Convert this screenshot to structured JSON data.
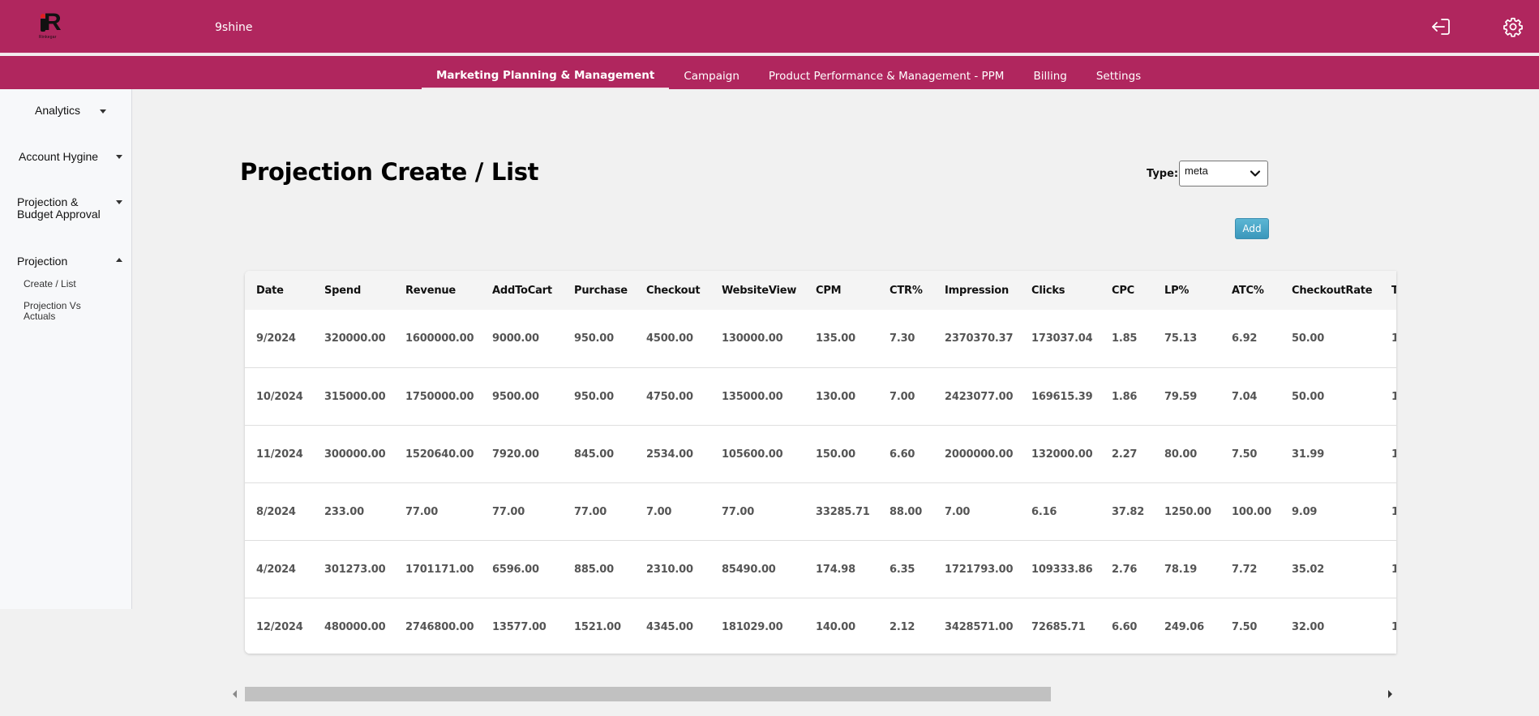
{
  "header": {
    "logo_text": "R",
    "logo_subtext": "Rinkegar",
    "org_name": "9shine",
    "icons": {
      "logout": "logout-icon",
      "settings": "gear-icon"
    },
    "brand_color": "#b0265e"
  },
  "nav": {
    "tabs": [
      {
        "label": "Marketing Planning & Management",
        "active": true
      },
      {
        "label": "Campaign",
        "active": false
      },
      {
        "label": "Product Performance & Management - PPM",
        "active": false
      },
      {
        "label": "Billing",
        "active": false
      },
      {
        "label": "Settings",
        "active": false
      }
    ]
  },
  "sidebar": {
    "items": [
      {
        "label": "Analytics",
        "expanded": false
      },
      {
        "label": "Account Hygine",
        "expanded": false
      },
      {
        "label": "Projection & Budget Approval",
        "line1": "Projection &",
        "line2": "Budget Approval",
        "expanded": false
      },
      {
        "label": "Projection",
        "expanded": true,
        "children": [
          {
            "label": "Create / List"
          },
          {
            "label": "Projection Vs Actuals",
            "line1": "Projection Vs",
            "line2": "Actuals"
          }
        ]
      }
    ]
  },
  "main": {
    "title": "Projection Create / List",
    "type_label": "Type:",
    "type_value": "meta",
    "add_label": "Add"
  },
  "table": {
    "columns": [
      "Date",
      "Spend",
      "Revenue",
      "AddToCart",
      "Purchase",
      "Checkout",
      "WebsiteView",
      "CPM",
      "CTR%",
      "Impression",
      "Clicks",
      "CPC",
      "LP%",
      "ATC%",
      "CheckoutRate",
      "T"
    ],
    "rows": [
      [
        "9/2024",
        "320000.00",
        "1600000.00",
        "9000.00",
        "950.00",
        "4500.00",
        "130000.00",
        "135.00",
        "7.30",
        "2370370.37",
        "173037.04",
        "1.85",
        "75.13",
        "6.92",
        "50.00",
        "1"
      ],
      [
        "10/2024",
        "315000.00",
        "1750000.00",
        "9500.00",
        "950.00",
        "4750.00",
        "135000.00",
        "130.00",
        "7.00",
        "2423077.00",
        "169615.39",
        "1.86",
        "79.59",
        "7.04",
        "50.00",
        "1"
      ],
      [
        "11/2024",
        "300000.00",
        "1520640.00",
        "7920.00",
        "845.00",
        "2534.00",
        "105600.00",
        "150.00",
        "6.60",
        "2000000.00",
        "132000.00",
        "2.27",
        "80.00",
        "7.50",
        "31.99",
        "1"
      ],
      [
        "8/2024",
        "233.00",
        "77.00",
        "77.00",
        "77.00",
        "7.00",
        "77.00",
        "33285.71",
        "88.00",
        "7.00",
        "6.16",
        "37.82",
        "1250.00",
        "100.00",
        "9.09",
        "1"
      ],
      [
        "4/2024",
        "301273.00",
        "1701171.00",
        "6596.00",
        "885.00",
        "2310.00",
        "85490.00",
        "174.98",
        "6.35",
        "1721793.00",
        "109333.86",
        "2.76",
        "78.19",
        "7.72",
        "35.02",
        "1"
      ],
      [
        "12/2024",
        "480000.00",
        "2746800.00",
        "13577.00",
        "1521.00",
        "4345.00",
        "181029.00",
        "140.00",
        "2.12",
        "3428571.00",
        "72685.71",
        "6.60",
        "249.06",
        "7.50",
        "32.00",
        "1"
      ]
    ]
  },
  "scrollbar": {
    "horizontal_position_fraction": 0.0,
    "visible_fraction": 0.71
  }
}
